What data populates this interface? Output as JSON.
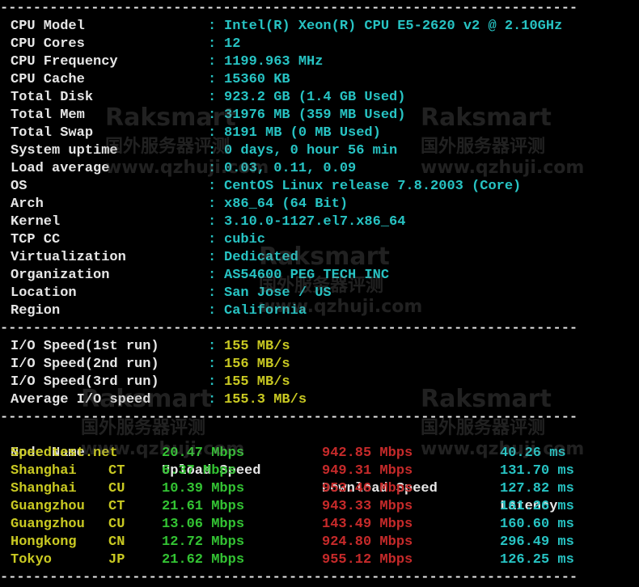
{
  "system_info": [
    {
      "label": "CPU Model",
      "value": "Intel(R) Xeon(R) CPU E5-2620 v2 @ 2.10GHz"
    },
    {
      "label": "CPU Cores",
      "value": "12"
    },
    {
      "label": "CPU Frequency",
      "value": "1199.963 MHz"
    },
    {
      "label": "CPU Cache",
      "value": "15360 KB"
    },
    {
      "label": "Total Disk",
      "value": "923.2 GB (1.4 GB Used)"
    },
    {
      "label": "Total Mem",
      "value": "31976 MB (359 MB Used)"
    },
    {
      "label": "Total Swap",
      "value": "8191 MB (0 MB Used)"
    },
    {
      "label": "System uptime",
      "value": "0 days, 0 hour 56 min"
    },
    {
      "label": "Load average",
      "value": "0.03, 0.11, 0.09"
    },
    {
      "label": "OS",
      "value": "CentOS Linux release 7.8.2003 (Core)"
    },
    {
      "label": "Arch",
      "value": "x86_64 (64 Bit)"
    },
    {
      "label": "Kernel",
      "value": "3.10.0-1127.el7.x86_64"
    },
    {
      "label": "TCP CC",
      "value": "cubic"
    },
    {
      "label": "Virtualization",
      "value": "Dedicated"
    },
    {
      "label": "Organization",
      "value": "AS54600 PEG TECH INC"
    },
    {
      "label": "Location",
      "value": "San Jose / US"
    },
    {
      "label": "Region",
      "value": "California"
    }
  ],
  "colon": ":",
  "separator": "----------------------------------------------------------------------",
  "io": [
    {
      "label": "I/O Speed(1st run)",
      "value": "155 MB/s"
    },
    {
      "label": "I/O Speed(2nd run)",
      "value": "156 MB/s"
    },
    {
      "label": "I/O Speed(3rd run)",
      "value": "155 MB/s"
    },
    {
      "label": "Average I/O speed",
      "value": "155.3 MB/s"
    }
  ],
  "speed_header": {
    "node": "Node Name",
    "upload": "Upload Speed",
    "download": "Download Speed",
    "latency": "Latency"
  },
  "speed_rows": [
    {
      "node": "Speedtest.net",
      "cc": "",
      "upload": "20.47 Mbps",
      "download": "942.85 Mbps",
      "latency": "40.26 ms"
    },
    {
      "node": "Shanghai",
      "cc": "CT",
      "upload": "6.37 Mbps",
      "download": "949.31 Mbps",
      "latency": "131.70 ms"
    },
    {
      "node": "Shanghai",
      "cc": "CU",
      "upload": "10.39 Mbps",
      "download": "953.46 Mbps",
      "latency": "127.82 ms"
    },
    {
      "node": "Guangzhou",
      "cc": "CT",
      "upload": "21.61 Mbps",
      "download": "943.33 Mbps",
      "latency": "161.26 ms"
    },
    {
      "node": "Guangzhou",
      "cc": "CU",
      "upload": "13.06 Mbps",
      "download": "143.49 Mbps",
      "latency": "160.60 ms"
    },
    {
      "node": "Hongkong",
      "cc": "CN",
      "upload": "12.72 Mbps",
      "download": "924.80 Mbps",
      "latency": "296.49 ms"
    },
    {
      "node": "Tokyo",
      "cc": "JP",
      "upload": "21.62 Mbps",
      "download": "955.12 Mbps",
      "latency": "126.25 ms"
    }
  ],
  "watermark": {
    "brand": "Raksmart",
    "cn": "国外服务器评测",
    "site": "www.qzhuji.com"
  },
  "colors": {
    "background": "#000000",
    "label": "#e6e6e6",
    "value": "#27c3c3",
    "node": "#c9c922",
    "upload": "#33c333",
    "download": "#c62a2a"
  }
}
